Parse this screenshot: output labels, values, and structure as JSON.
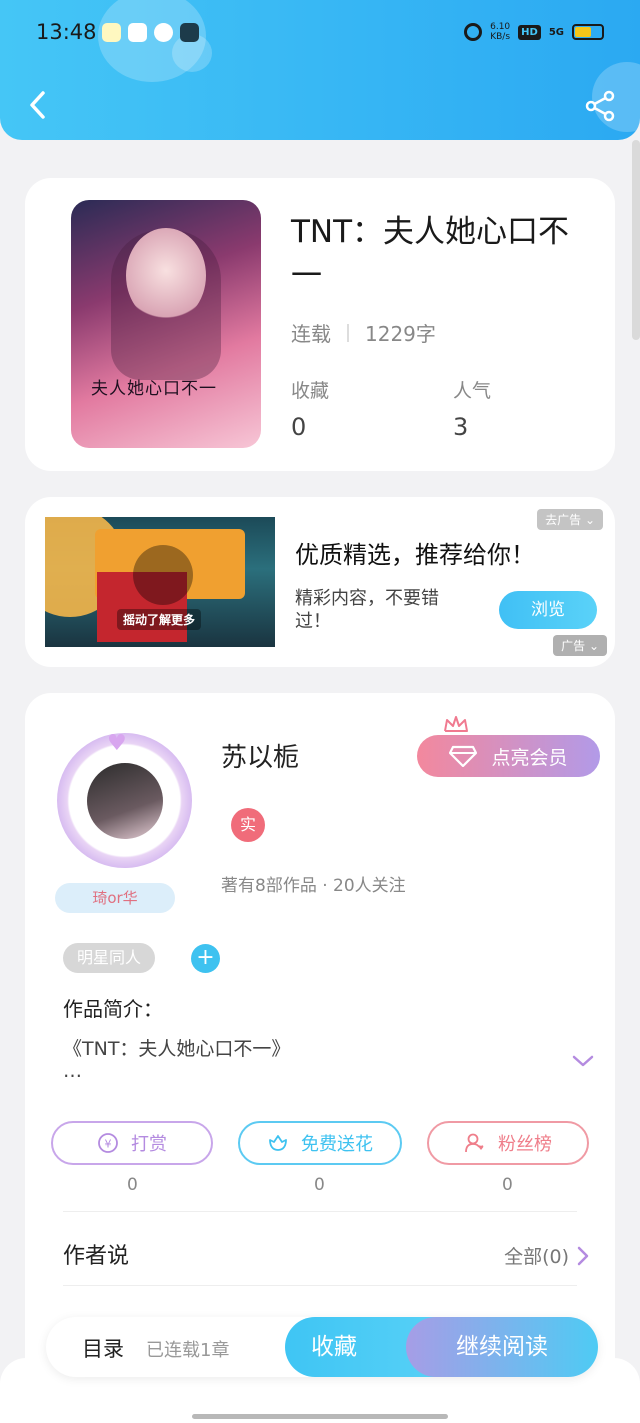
{
  "status_bar": {
    "time": "13:48",
    "net_speed_value": "6.10",
    "net_speed_unit": "KB/s",
    "hd": "HD",
    "signal": "5G"
  },
  "header": {
    "back_icon": "chevron-left-icon",
    "share_icon": "share-icon",
    "accent": "#2ba9f2"
  },
  "book": {
    "title": "TNT：夫人她心口不一",
    "status": "连载",
    "word_count": "1229字",
    "favorites_label": "收藏",
    "favorites_value": "0",
    "popularity_label": "人气",
    "popularity_value": "3",
    "cover_text": "夫人她心口不一"
  },
  "ad": {
    "remove_label": "去广告",
    "title": "优质精选，推荐给你！",
    "subtitle": "精彩内容，不要错过！",
    "button": "浏览",
    "image_caption": "摇动了解更多",
    "ad_label": "广告"
  },
  "author": {
    "name": "苏以栀",
    "nickname": "琦or华",
    "vip_button": "点亮会员",
    "verified_badge": "实",
    "works": "著有8部作品 · 20人关注",
    "tag": "明星同人",
    "add_tag": "+",
    "intro_heading": "作品简介：",
    "intro_line1": "《TNT：夫人她心口不一》",
    "intro_line2": "…"
  },
  "actions": [
    {
      "label": "打赏",
      "count": "0",
      "icon": "yen-coin-icon",
      "color": "#b48be0"
    },
    {
      "label": "免费送花",
      "count": "0",
      "icon": "flower-icon",
      "color": "#3ec2f0"
    },
    {
      "label": "粉丝榜",
      "count": "0",
      "icon": "fans-icon",
      "color": "#ef7e8a"
    }
  ],
  "author_says": {
    "label": "作者说",
    "all": "全部(0)"
  },
  "bottom_bar": {
    "toc": "目录",
    "serial": "已连载1章",
    "favorite": "收藏",
    "continue": "继续阅读"
  }
}
